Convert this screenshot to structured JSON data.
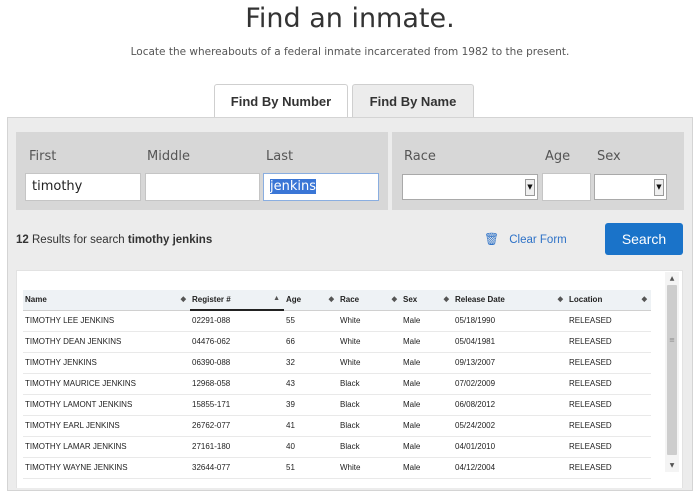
{
  "header": {
    "title": "Find an inmate.",
    "subtitle": "Locate the whereabouts of a federal inmate incarcerated from 1982 to the present."
  },
  "tabs": [
    {
      "label": "Find By Number",
      "active": false
    },
    {
      "label": "Find By Name",
      "active": true
    }
  ],
  "form": {
    "first_label": "First",
    "middle_label": "Middle",
    "last_label": "Last",
    "race_label": "Race",
    "age_label": "Age",
    "sex_label": "Sex",
    "first_value": "timothy",
    "middle_value": "",
    "last_value": "jenkins",
    "age_value": "",
    "race_value": "",
    "sex_value": ""
  },
  "results": {
    "count": "12",
    "text": " Results for search ",
    "query": "timothy jenkins"
  },
  "actions": {
    "clear_label": "Clear Form",
    "search_label": "Search"
  },
  "table": {
    "columns": [
      "Name",
      "Register #",
      "Age",
      "Race",
      "Sex",
      "Release Date",
      "Location"
    ],
    "rows": [
      [
        "TIMOTHY LEE JENKINS",
        "02291-088",
        "55",
        "White",
        "Male",
        "05/18/1990",
        "RELEASED"
      ],
      [
        "TIMOTHY DEAN JENKINS",
        "04476-062",
        "66",
        "White",
        "Male",
        "05/04/1981",
        "RELEASED"
      ],
      [
        "TIMOTHY JENKINS",
        "06390-088",
        "32",
        "White",
        "Male",
        "09/13/2007",
        "RELEASED"
      ],
      [
        "TIMOTHY MAURICE JENKINS",
        "12968-058",
        "43",
        "Black",
        "Male",
        "07/02/2009",
        "RELEASED"
      ],
      [
        "TIMOTHY LAMONT JENKINS",
        "15855-171",
        "39",
        "Black",
        "Male",
        "06/08/2012",
        "RELEASED"
      ],
      [
        "TIMOTHY EARL JENKINS",
        "26762-077",
        "41",
        "Black",
        "Male",
        "05/24/2002",
        "RELEASED"
      ],
      [
        "TIMOTHY LAMAR JENKINS",
        "27161-180",
        "40",
        "Black",
        "Male",
        "04/01/2010",
        "RELEASED"
      ],
      [
        "TIMOTHY WAYNE JENKINS",
        "32644-077",
        "51",
        "White",
        "Male",
        "04/12/2004",
        "RELEASED"
      ]
    ]
  },
  "colors": {
    "accent": "#1a73c9",
    "link": "#2e72c7",
    "panel": "#ececec",
    "field_group": "#d7d7d7"
  }
}
